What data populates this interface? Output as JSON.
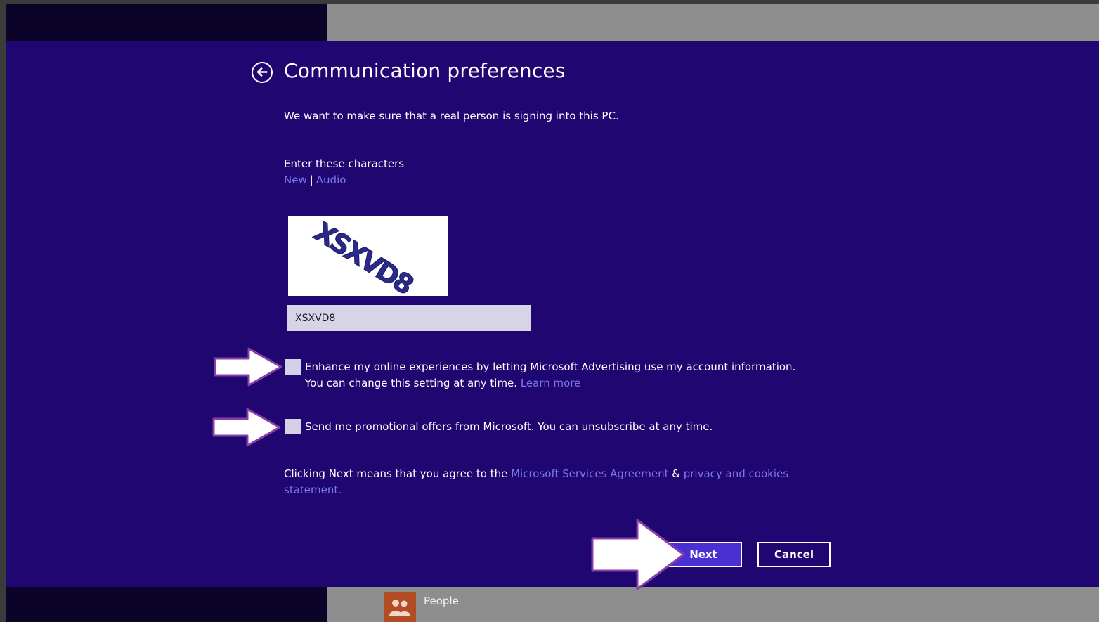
{
  "page": {
    "title": "Communication preferences",
    "intro": "We want to make sure that a real person is signing into this PC.",
    "enter_label": "Enter these characters",
    "link_new": "New",
    "link_separator": "|",
    "link_audio": "Audio"
  },
  "captcha": {
    "image_text": "XSXVD8",
    "input_value": "XSXVD8"
  },
  "options": {
    "advertising_line1": "Enhance my online experiences by letting Microsoft Advertising use my account information.",
    "advertising_line2": "You can change this setting at any time.",
    "learn_more": "Learn more",
    "advertising_checked": false,
    "promo_label": "Send me promotional offers from Microsoft. You can unsubscribe at any time.",
    "promo_checked": false
  },
  "agreement": {
    "prefix": "Clicking Next means that you agree to the",
    "msa_link": "Microsoft Services Agreement",
    "ampersand": "&",
    "privacy_link_part1": "privacy and cookies",
    "privacy_link_part2": "statement."
  },
  "buttons": {
    "next": "Next",
    "cancel": "Cancel"
  },
  "taskbar": {
    "people_label": "People",
    "people_icon": "people-icon"
  },
  "colors": {
    "background": "#200670",
    "link": "#7a78ea",
    "next_button": "#4a2fd2",
    "people_tile": "#b24c24",
    "annotation_arrow": "#ffffff",
    "annotation_arrow_outline": "#8a3fa8"
  }
}
